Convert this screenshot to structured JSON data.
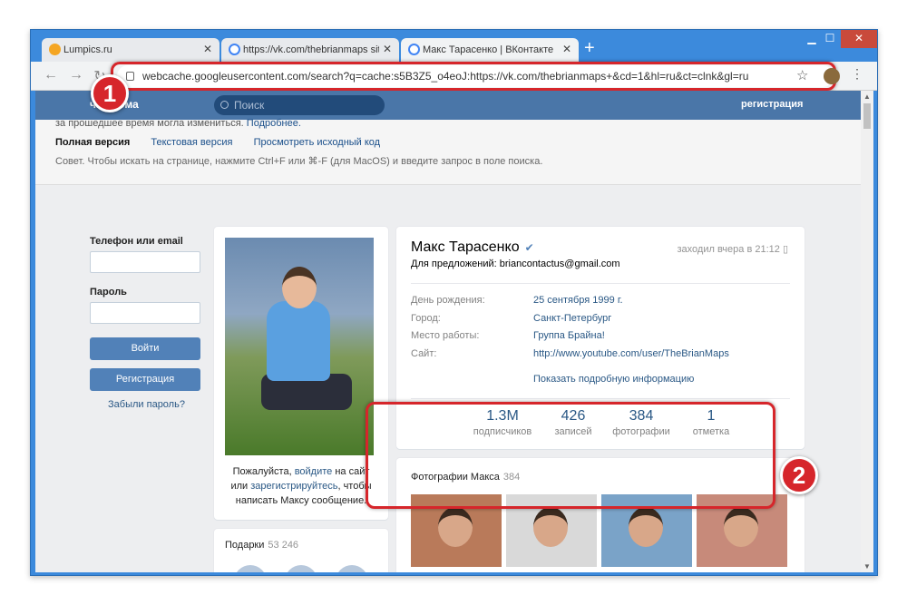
{
  "browser": {
    "tabs": [
      {
        "title": "Lumpics.ru"
      },
      {
        "title": "https://vk.com/thebrianmaps site"
      },
      {
        "title": "Макс Тарасенко | ВКонтакте"
      }
    ],
    "new_tab": "+",
    "url": "webcache.googleusercontent.com/search?q=cache:s5B3Z5_o4eoJ:https://vk.com/thebrianmaps+&cd=1&hl=ru&ct=clnk&gl=ru"
  },
  "vk": {
    "logo_text": "чшедома",
    "search_placeholder": "Поиск",
    "register_link": "регистрация"
  },
  "cache": {
    "line1_text": "за прошедшее время могла измениться.",
    "line1_link": "Подробнее.",
    "full_version": "Полная версия",
    "text_version": "Текстовая версия",
    "view_source": "Просмотреть исходный код",
    "tip": "Совет. Чтобы искать на странице, нажмите Ctrl+F или ⌘-F (для MacOS) и введите запрос в поле поиска."
  },
  "login": {
    "phone_label": "Телефон или email",
    "password_label": "Пароль",
    "login_button": "Войти",
    "register_button": "Регистрация",
    "forgot": "Забыли пароль?"
  },
  "photo_caption": {
    "before": "Пожалуйста, ",
    "login_link": "войдите",
    "middle": " на сайт или ",
    "register_link": "зарегистрируйтесь",
    "after": ", чтобы написать Максу сообщение."
  },
  "gifts": {
    "title": "Подарки",
    "count": "53 246"
  },
  "profile": {
    "name": "Макс Тарасенко",
    "last_seen": "заходил вчера в 21:12",
    "status": "Для предложений: briancontactus@gmail.com",
    "rows": [
      {
        "label": "День рождения:",
        "value": "25 сентября 1999 г."
      },
      {
        "label": "Город:",
        "value": "Санкт-Петербург"
      },
      {
        "label": "Место работы:",
        "value": "Группа Брайна!"
      },
      {
        "label": "Сайт:",
        "value": "http://www.youtube.com/user/TheBrianMaps"
      }
    ],
    "more_info": "Показать подробную информацию",
    "counters": [
      {
        "num": "1.3M",
        "label": "подписчиков"
      },
      {
        "num": "426",
        "label": "записей"
      },
      {
        "num": "384",
        "label": "фотографии"
      },
      {
        "num": "1",
        "label": "отметка"
      }
    ]
  },
  "photos": {
    "title": "Фотографии Макса",
    "count": "384"
  },
  "badges": [
    "1",
    "2"
  ]
}
